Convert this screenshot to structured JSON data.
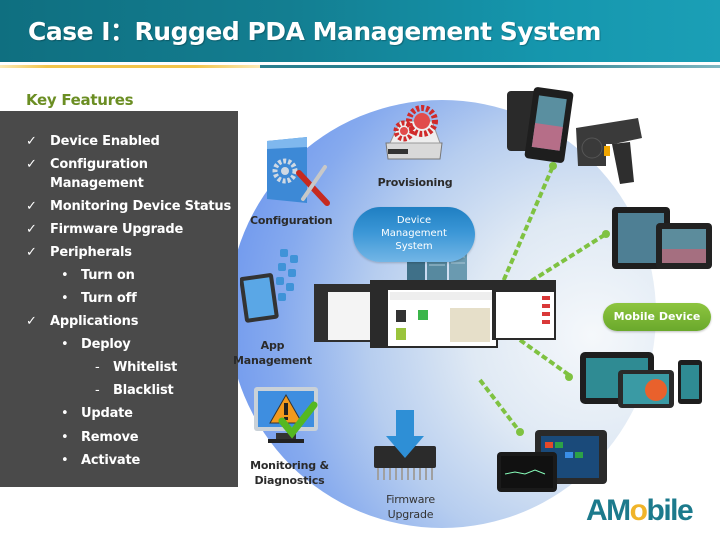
{
  "header": {
    "title": "Case I：Rugged PDA Management System"
  },
  "key_features": {
    "heading": "Key Features",
    "items": [
      {
        "level": 1,
        "marker": "✓",
        "text": " Device Enabled"
      },
      {
        "level": 1,
        "marker": "✓",
        "text": "Configuration"
      },
      {
        "level": 1,
        "marker": "",
        "text": "Management"
      },
      {
        "level": 1,
        "marker": "✓",
        "text": "Monitoring Device Status"
      },
      {
        "level": 1,
        "marker": "✓",
        "text": "Firmware Upgrade"
      },
      {
        "level": 1,
        "marker": "✓",
        "text": "Peripherals"
      },
      {
        "level": 2,
        "marker": "•",
        "text": "Turn on"
      },
      {
        "level": 2,
        "marker": "•",
        "text": "Turn off"
      },
      {
        "level": 1,
        "marker": "✓",
        "text": "Applications"
      },
      {
        "level": 2,
        "marker": "•",
        "text": "Deploy"
      },
      {
        "level": 3,
        "marker": "-",
        "text": "Whitelist"
      },
      {
        "level": 3,
        "marker": "-",
        "text": "Blacklist"
      },
      {
        "level": 2,
        "marker": "•",
        "text": "Update"
      },
      {
        "level": 2,
        "marker": "•",
        "text": "Remove"
      },
      {
        "level": 2,
        "marker": "•",
        "text": "Activate"
      }
    ]
  },
  "diagram": {
    "center": {
      "line1": "Device",
      "line2": "Management",
      "line3": "System"
    },
    "modules": {
      "provisioning": "Provisioning",
      "configuration": "Configuration",
      "app_management_1": "App",
      "app_management_2": "Management",
      "monitoring_1": "Monitoring &",
      "monitoring_2": "Diagnostics",
      "firmware_1": "Firmware",
      "firmware_2": "Upgrade"
    },
    "mobile_device_label": "Mobile Device",
    "connector_color": "#7fc241"
  },
  "brand": {
    "logo_a": "A",
    "logo_m": "M",
    "logo_o": "o",
    "logo_rest": "bile",
    "primary_color": "#1c7a8c",
    "accent_color": "#f0b429"
  }
}
